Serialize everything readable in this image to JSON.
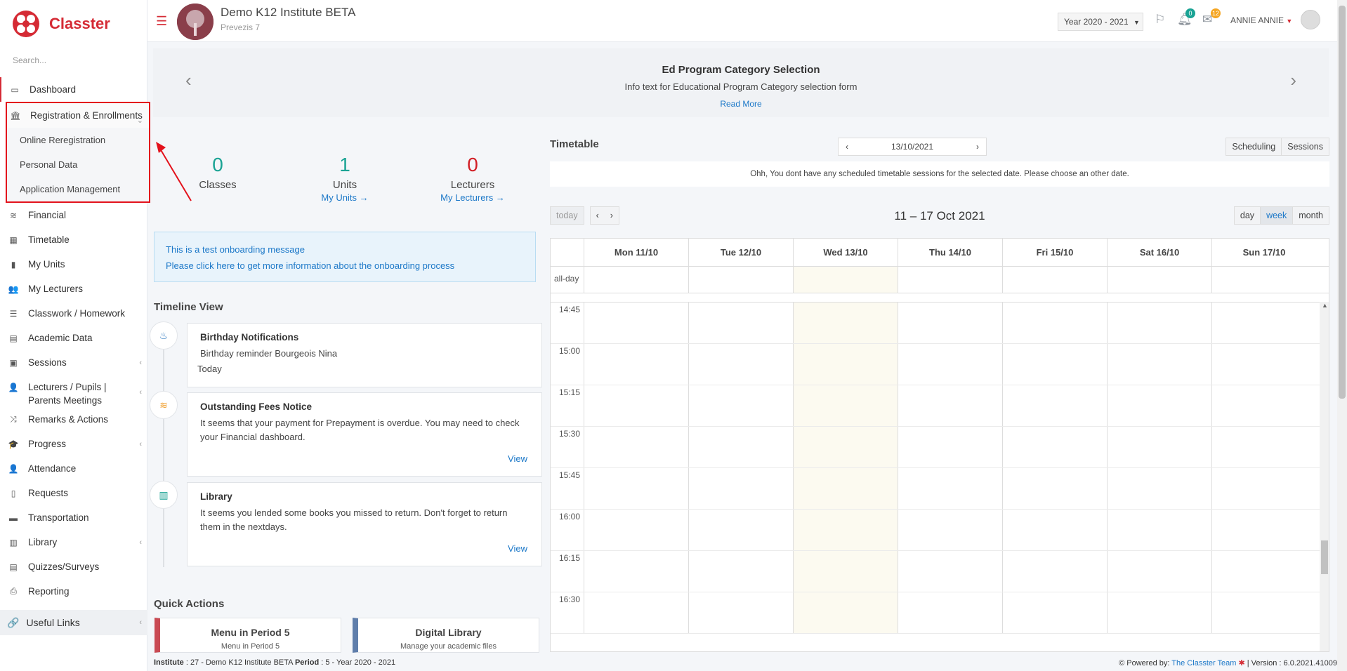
{
  "app": {
    "name": "Classter",
    "brand_color": "#d52b35",
    "link_color": "#1c78c8",
    "search_placeholder": "Search..."
  },
  "sidebar": {
    "items": [
      {
        "label": "Dashboard",
        "icon": "laptop-icon"
      },
      {
        "label": "Registration & Enrollments",
        "icon": "bank-icon",
        "expanded": true,
        "children": [
          "Online Reregistration",
          "Personal Data",
          "Application Management"
        ]
      },
      {
        "label": "Financial",
        "icon": "coins-icon"
      },
      {
        "label": "Timetable",
        "icon": "calendar-icon"
      },
      {
        "label": "My Units",
        "icon": "book-icon"
      },
      {
        "label": "My Lecturers",
        "icon": "users-icon"
      },
      {
        "label": "Classwork / Homework",
        "icon": "list-icon"
      },
      {
        "label": "Academic Data",
        "icon": "chart-icon"
      },
      {
        "label": "Sessions",
        "icon": "presentation-icon"
      },
      {
        "label": "Lecturers / Pupils | Parents Meetings",
        "icon": "user-meeting-icon"
      },
      {
        "label": "Remarks & Actions",
        "icon": "shuffle-icon"
      },
      {
        "label": "Progress",
        "icon": "graduation-cap-icon"
      },
      {
        "label": "Attendance",
        "icon": "user-check-icon"
      },
      {
        "label": "Requests",
        "icon": "document-icon"
      },
      {
        "label": "Transportation",
        "icon": "bus-icon"
      },
      {
        "label": "Library",
        "icon": "books-icon"
      },
      {
        "label": "Quizzes/Surveys",
        "icon": "clipboard-icon"
      },
      {
        "label": "Reporting",
        "icon": "printer-icon"
      }
    ],
    "useful_links": "Useful Links"
  },
  "topbar": {
    "institute": "Demo K12 Institute BETA",
    "address": "Prevezis 7",
    "year": "Year 2020 - 2021",
    "notifications": "0",
    "messages": "12",
    "user": "ANNIE ANNIE"
  },
  "banner": {
    "title": "Ed Program Category Selection",
    "text": "Info text for Educational Program Category selection form",
    "link": "Read More"
  },
  "stats": [
    {
      "value": "0",
      "label": "Classes",
      "link": "",
      "color": "#1aa394"
    },
    {
      "value": "1",
      "label": "Units",
      "link": "My Units →",
      "color": "#1aa394"
    },
    {
      "value": "0",
      "label": "Lecturers",
      "link": "My Lecturers →",
      "color": "#d21f26"
    }
  ],
  "onboarding": {
    "line1": "This is a test onboarding message",
    "line2": "Please click here to get more information about the onboarding process"
  },
  "timeline": {
    "title": "Timeline View",
    "cards": [
      {
        "title": "Birthday Notifications",
        "body": "Birthday reminder Bourgeois Nina",
        "meta": "Today",
        "icon": "cake-icon"
      },
      {
        "title": "Outstanding Fees Notice",
        "body": "It seems that your payment for Prepayment is overdue. You may need to check your Financial dashboard.",
        "link": "View",
        "icon": "coins-icon"
      },
      {
        "title": "Library",
        "body": "It seems you lended some books you missed to return. Don't forget to return them in the nextdays.",
        "link": "View",
        "icon": "books-icon"
      }
    ]
  },
  "quick_actions": {
    "title": "Quick Actions",
    "items": [
      {
        "title": "Menu in Period 5",
        "sub": "Menu in Period 5",
        "color": "#c94a53"
      },
      {
        "title": "Digital Library",
        "sub": "Manage your academic files",
        "color": "#5f7eab"
      }
    ]
  },
  "timetable": {
    "title": "Timetable",
    "date": "13/10/2021",
    "buttons": [
      "Scheduling",
      "Sessions"
    ],
    "no_sessions": "Ohh, You dont have any scheduled timetable sessions for the selected date. Please choose an other date.",
    "today_btn": "today",
    "range": "11 – 17 Oct 2021",
    "views": [
      "day",
      "week",
      "month"
    ],
    "active_view": "week",
    "days": [
      "Mon 11/10",
      "Tue 12/10",
      "Wed 13/10",
      "Thu 14/10",
      "Fri 15/10",
      "Sat 16/10",
      "Sun 17/10"
    ],
    "allday": "all-day",
    "times": [
      "14:45",
      "15:00",
      "15:15",
      "15:30",
      "15:45",
      "16:00",
      "16:15",
      "16:30"
    ]
  },
  "footer": {
    "left_label1": "Institute",
    "left_val1": ": 27 - Demo K12 Institute BETA",
    "left_label2": "Period",
    "left_val2": ": 5 - Year 2020 - 2021",
    "powered": "Powered by:",
    "powered_link": "The Classter Team",
    "version": "| Version : 6.0.2021.41009"
  }
}
